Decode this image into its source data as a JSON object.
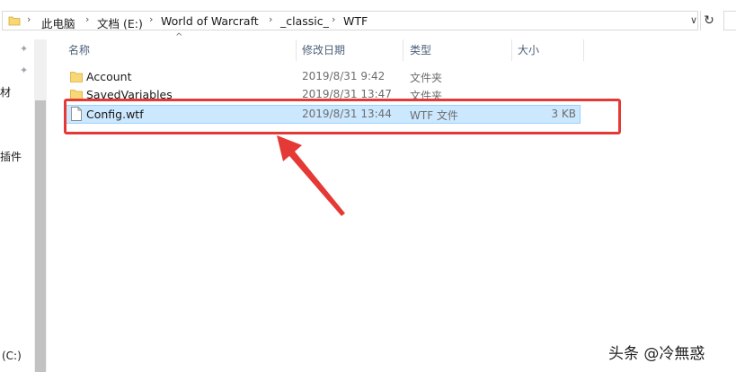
{
  "address_bar": {
    "crumbs": [
      "此电脑",
      "文档 (E:)",
      "World of Warcraft",
      "_classic_",
      "WTF"
    ]
  },
  "nav": {
    "items": [
      "材",
      "插件",
      "(C:)"
    ]
  },
  "columns": {
    "name": "名称",
    "modified": "修改日期",
    "type": "类型",
    "size": "大小"
  },
  "files": [
    {
      "name": "Account",
      "modified": "2019/8/31 9:42",
      "type": "文件夹",
      "size": "",
      "kind": "folder",
      "selected": false
    },
    {
      "name": "SavedVariables",
      "modified": "2019/8/31 13:47",
      "type": "文件夹",
      "size": "",
      "kind": "folder",
      "selected": false
    },
    {
      "name": "Config.wtf",
      "modified": "2019/8/31 13:44",
      "type": "WTF 文件",
      "size": "3 KB",
      "kind": "file",
      "selected": true
    }
  ],
  "annotation": {
    "highlight_color": "#e53935"
  },
  "watermark": "头条 @冷無惑",
  "colors": {
    "selection_bg": "#cce8ff",
    "selection_border": "#99d1ff",
    "header_text": "#4c607a",
    "folder_yellow": "#f8d775"
  }
}
